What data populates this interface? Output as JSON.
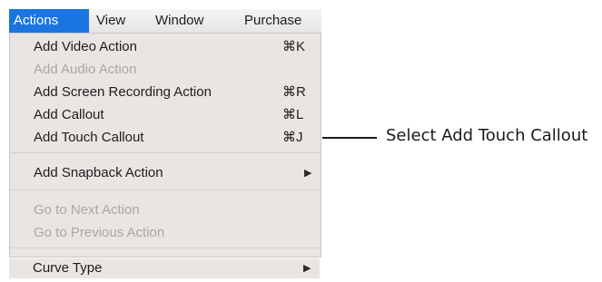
{
  "menubar": {
    "items": [
      {
        "label": "Actions",
        "active": true
      },
      {
        "label": "View"
      },
      {
        "label": "Window"
      },
      {
        "label": "Purchase"
      }
    ]
  },
  "menu": {
    "items": [
      {
        "label": "Add Video Action",
        "shortcut": "⌘K",
        "enabled": true
      },
      {
        "label": "Add Audio Action",
        "shortcut": "",
        "enabled": false
      },
      {
        "label": "Add Screen Recording Action",
        "shortcut": "⌘R",
        "enabled": true
      },
      {
        "label": "Add Callout",
        "shortcut": "⌘L",
        "enabled": true
      },
      {
        "label": "Add Touch Callout",
        "shortcut": "⌘J",
        "enabled": true
      },
      {
        "label": "Add Snapback Action",
        "submenu_arrow": "▶",
        "enabled": true
      },
      {
        "label": "Go to Next Action",
        "enabled": false
      },
      {
        "label": "Go to Previous Action",
        "enabled": false
      },
      {
        "label": "Curve Type",
        "submenu_arrow": "▶",
        "enabled": true
      }
    ]
  },
  "annotation": {
    "text": "Select Add Touch Callout"
  },
  "colors": {
    "accent": "#1b75e0",
    "menu_background": "#e9e5e3",
    "disabled_text": "#aaa7a5"
  }
}
